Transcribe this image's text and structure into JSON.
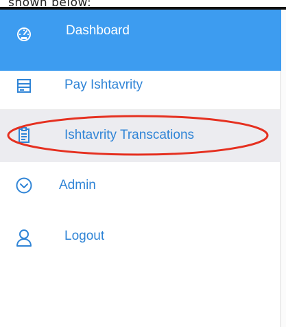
{
  "caption": "shown below:",
  "sidebar": {
    "items": [
      {
        "label": "Dashboard",
        "icon": "dashboard-gauge-icon",
        "active": true
      },
      {
        "label": "Pay Ishtavrity",
        "icon": "receipt-icon",
        "active": false
      },
      {
        "label": "Ishtavrity Transcations",
        "icon": "clipboard-icon",
        "active": false,
        "highlighted": true
      },
      {
        "label": "Admin",
        "icon": "chevron-down-circle-icon",
        "active": false
      },
      {
        "label": "Logout",
        "icon": "user-icon",
        "active": false
      }
    ]
  },
  "colors": {
    "active_bg": "#3d9cf0",
    "link": "#2f84d6",
    "hover_bg": "#ececf0",
    "annotation": "#e53020"
  }
}
